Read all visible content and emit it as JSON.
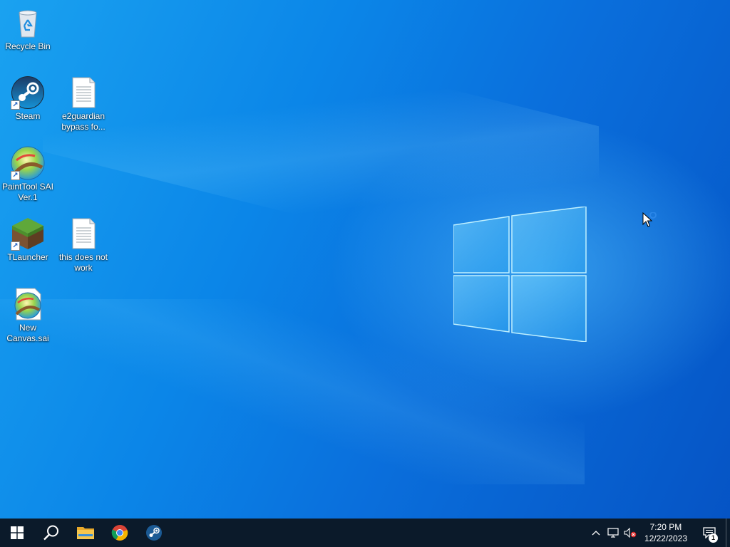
{
  "desktop": {
    "icons": [
      {
        "label": "Recycle Bin",
        "icon": "recycle-bin-icon"
      },
      {
        "label": "Steam",
        "icon": "steam-icon"
      },
      {
        "label": "e2guardian bypass fo...",
        "icon": "text-document-icon"
      },
      {
        "label": "PaintTool SAI Ver.1",
        "icon": "painttool-sai-icon"
      },
      {
        "label": "TLauncher",
        "icon": "tlauncher-icon"
      },
      {
        "label": "this does not work",
        "icon": "text-document-icon"
      },
      {
        "label": "New Canvas.sai",
        "icon": "sai-file-icon"
      }
    ]
  },
  "taskbar": {
    "pinned": [
      {
        "name": "start",
        "icon": "windows-start-icon"
      },
      {
        "name": "search",
        "icon": "search-icon"
      },
      {
        "name": "file-explorer",
        "icon": "folder-icon"
      },
      {
        "name": "chrome",
        "icon": "chrome-icon"
      },
      {
        "name": "steam",
        "icon": "steam-icon"
      }
    ],
    "tray": {
      "time": "7:20 PM",
      "date": "12/22/2023",
      "notification_count": "1",
      "icons": [
        "chevron-up-icon",
        "network-icon",
        "volume-muted-icon"
      ]
    }
  },
  "colors": {
    "taskbar": "#0b1a2a",
    "accent": "#0a78e0"
  }
}
